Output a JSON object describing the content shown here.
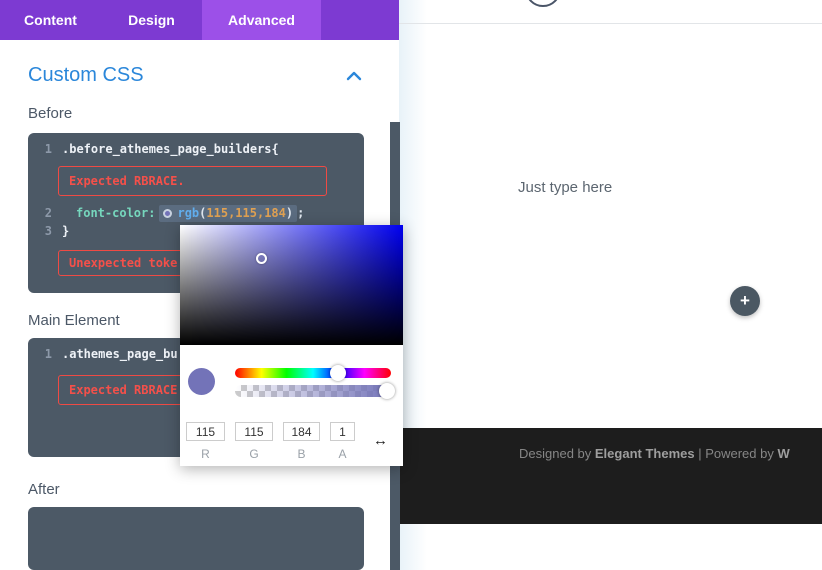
{
  "tabs": {
    "content": "Content",
    "design": "Design",
    "advanced": "Advanced"
  },
  "section": {
    "title": "Custom CSS"
  },
  "before": {
    "label": "Before",
    "line1_num": "1",
    "line1_code": ".before_athemes_page_builders{",
    "error1": "Expected RBRACE.",
    "line2_num": "2",
    "line2_prop": "font-color:",
    "line2_fn": "rgb",
    "line2_open": "(",
    "line2_args": "115,115,184",
    "line2_close": ")",
    "line2_semi": ";",
    "line3_num": "3",
    "line3_code": "}",
    "error2": "Unexpected toke"
  },
  "main_element": {
    "label": "Main Element",
    "line1_num": "1",
    "line1_code": ".athemes_page_bu",
    "error1": "Expected RBRACE"
  },
  "after": {
    "label": "After"
  },
  "picker": {
    "r": "115",
    "g": "115",
    "b": "184",
    "a": "1",
    "r_label": "R",
    "g_label": "G",
    "b_label": "B",
    "a_label": "A",
    "swatch_color": "#7373b8",
    "swap_icon": "↔"
  },
  "canvas": {
    "placeholder": "Just type here",
    "add_button": "+",
    "footer_pre": "Designed by ",
    "footer_brand": "Elegant Themes",
    "footer_mid": " | Powered by ",
    "footer_brand2": "W"
  },
  "colors": {
    "tab_bar": "#7d3ad2",
    "tab_active": "#9c50e8",
    "accent_blue": "#2b87da",
    "editor_bg": "#4c5966",
    "error_red": "#ef4a44",
    "swatch": "#7373b8",
    "footer_bg": "#1d1d1d"
  }
}
